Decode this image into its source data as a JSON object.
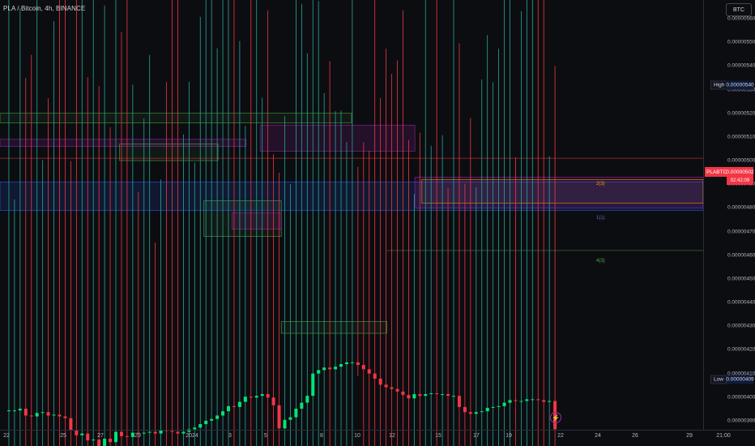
{
  "header": {
    "title": "PLA / Bitcoin, 4h, BINANCE"
  },
  "price_axis": {
    "currency": "BTC",
    "ticks": [
      "0.00000560",
      "0.00000550",
      "0.00000540",
      "0.00000530",
      "0.00000520",
      "0.00000510",
      "0.00000500",
      "0.00000490",
      "0.00000480",
      "0.00000470",
      "0.00000460",
      "0.00000450",
      "0.00000440",
      "0.00000430",
      "0.00000420",
      "0.00000410",
      "0.00000400",
      "0.00000390"
    ],
    "high_label": "High",
    "high_value": "0.00000540",
    "low_label": "Low",
    "low_value": "0.00000409",
    "symbol": "PLABTC",
    "current_price": "0.00000502",
    "countdown": "02:42:09"
  },
  "time_axis": {
    "ticks": [
      "22",
      "25",
      "27",
      "29",
      "2024",
      "3",
      "5",
      "8",
      "10",
      "12",
      "15",
      "17",
      "19",
      "22",
      "24",
      "26",
      "29",
      "21:00"
    ]
  },
  "levels": {
    "l1": "2(3)",
    "l2": "1(1)",
    "l3": "4(3)"
  },
  "colors": {
    "bull": "#26a69a",
    "bull_bright": "#00e676",
    "bear": "#f23645",
    "zone_green": "#4caf50",
    "zone_purple": "#9c27b0",
    "zone_blue": "#2962ff",
    "background": "#0c0d10"
  },
  "chart_data": {
    "type": "candlestick",
    "symbol": "PLA / Bitcoin",
    "timeframe": "4h",
    "exchange": "BINANCE",
    "y_unit": "BTC",
    "ylim": [
      3.87e-06,
      5.73e-06
    ],
    "x_labels": [
      "22",
      "25",
      "27",
      "29",
      "2024",
      "3",
      "5",
      "8",
      "10",
      "12",
      "15",
      "17",
      "19",
      "22",
      "24",
      "26",
      "29"
    ],
    "path_points": [
      [
        0,
        481
      ],
      [
        1,
        480
      ],
      [
        2,
        480
      ],
      [
        3,
        478
      ],
      [
        4,
        486
      ],
      [
        5,
        487
      ],
      [
        6,
        483
      ],
      [
        7,
        482
      ],
      [
        8,
        486
      ],
      [
        9,
        485
      ],
      [
        10,
        487
      ],
      [
        11,
        489
      ],
      [
        12,
        503
      ],
      [
        13,
        509
      ],
      [
        14,
        507
      ],
      [
        15,
        515
      ],
      [
        16,
        514
      ],
      [
        17,
        522
      ],
      [
        18,
        513
      ],
      [
        19,
        517
      ],
      [
        20,
        505
      ],
      [
        21,
        510
      ],
      [
        22,
        511
      ],
      [
        23,
        506
      ],
      [
        24,
        507
      ],
      [
        25,
        506
      ],
      [
        26,
        505
      ],
      [
        27,
        507
      ],
      [
        28,
        503
      ],
      [
        29,
        504
      ],
      [
        30,
        505
      ],
      [
        31,
        507
      ],
      [
        32,
        505
      ],
      [
        33,
        502
      ],
      [
        34,
        500
      ],
      [
        35,
        496
      ],
      [
        36,
        492
      ],
      [
        37,
        490
      ],
      [
        38,
        486
      ],
      [
        39,
        481
      ],
      [
        40,
        475
      ],
      [
        41,
        476
      ],
      [
        42,
        470
      ],
      [
        43,
        464
      ],
      [
        44,
        465
      ],
      [
        45,
        463
      ],
      [
        46,
        461
      ],
      [
        47,
        465
      ],
      [
        48,
        474
      ],
      [
        49,
        501
      ],
      [
        50,
        491
      ],
      [
        51,
        488
      ],
      [
        52,
        478
      ],
      [
        53,
        471
      ],
      [
        54,
        463
      ],
      [
        55,
        437
      ],
      [
        56,
        433
      ],
      [
        57,
        430
      ],
      [
        58,
        432
      ],
      [
        59,
        429
      ],
      [
        60,
        426
      ],
      [
        61,
        424
      ],
      [
        62,
        424
      ],
      [
        63,
        427
      ],
      [
        64,
        432
      ],
      [
        65,
        437
      ],
      [
        66,
        443
      ],
      [
        67,
        450
      ],
      [
        68,
        453
      ],
      [
        69,
        455
      ],
      [
        70,
        458
      ],
      [
        71,
        462
      ],
      [
        72,
        466
      ],
      [
        73,
        461
      ],
      [
        74,
        463
      ],
      [
        75,
        461
      ],
      [
        76,
        460
      ],
      [
        77,
        461
      ],
      [
        78,
        461
      ],
      [
        79,
        463
      ],
      [
        80,
        463
      ],
      [
        81,
        476
      ],
      [
        82,
        482
      ],
      [
        83,
        484
      ],
      [
        84,
        482
      ],
      [
        85,
        481
      ],
      [
        86,
        477
      ],
      [
        87,
        476
      ],
      [
        88,
        475
      ],
      [
        89,
        471
      ],
      [
        90,
        468
      ],
      [
        91,
        469
      ],
      [
        92,
        469
      ],
      [
        93,
        467
      ],
      [
        94,
        467
      ],
      [
        95,
        468
      ],
      [
        96,
        470
      ],
      [
        97,
        469
      ],
      [
        98,
        502
      ]
    ],
    "high": 5.4e-06,
    "low": 4.09e-06,
    "last": 5.02e-06,
    "zones": [
      {
        "color": "green",
        "from": 0,
        "to": 50,
        "top": 5.2e-06,
        "bottom": 5.16e-06
      },
      {
        "color": "purple",
        "from": 0,
        "to": 35,
        "top": 5.09e-06,
        "bottom": 5.06e-06
      },
      {
        "color": "green",
        "from": 17,
        "to": 31,
        "top": 5.07e-06,
        "bottom": 5e-06
      },
      {
        "color": "purple",
        "from": 37,
        "to": 59,
        "top": 5.15e-06,
        "bottom": 5.04e-06
      },
      {
        "color": "blue",
        "from": 0,
        "to": 100,
        "top": 4.91e-06,
        "bottom": 4.79e-06
      },
      {
        "color": "green",
        "from": 29,
        "to": 40,
        "top": 4.83e-06,
        "bottom": 4.68e-06
      },
      {
        "color": "purple",
        "from": 33,
        "to": 40,
        "top": 4.78e-06,
        "bottom": 4.71e-06
      },
      {
        "color": "purple",
        "from": 59,
        "to": 100,
        "top": 4.93e-06,
        "bottom": 4.8e-06
      },
      {
        "color": "orange",
        "from": 60,
        "to": 100,
        "top": 4.92e-06,
        "bottom": 4.82e-06
      },
      {
        "color": "green",
        "from": 40,
        "to": 55,
        "top": 4.32e-06,
        "bottom": 4.27e-06
      }
    ],
    "lines": [
      {
        "color": "red",
        "value": 5.01e-06
      },
      {
        "color": "green",
        "from": 55,
        "value": 4.62e-06
      }
    ]
  }
}
